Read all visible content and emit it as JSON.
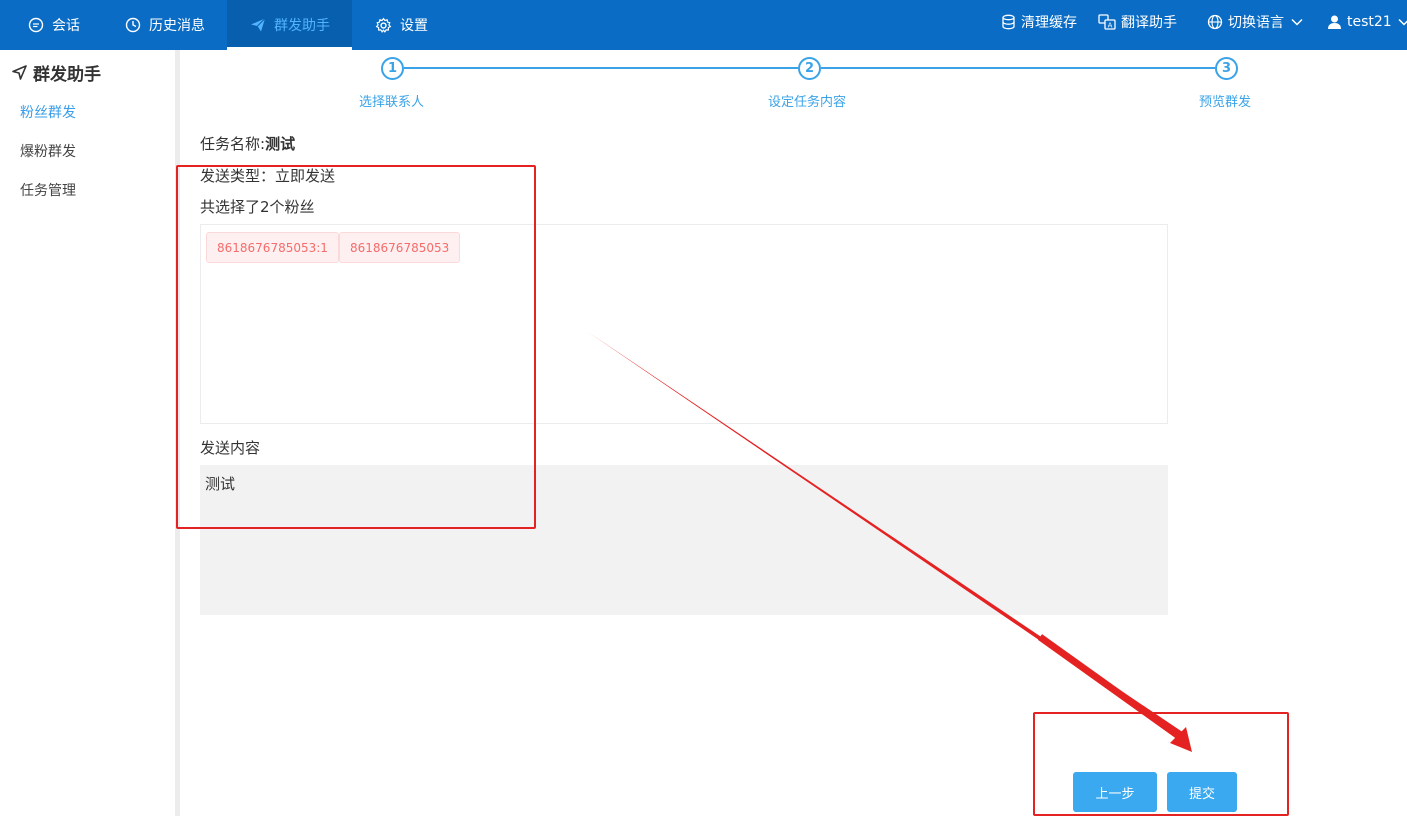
{
  "topnav": {
    "items": [
      {
        "label": "会话",
        "icon": "chat-icon"
      },
      {
        "label": "历史消息",
        "icon": "clock-icon"
      },
      {
        "label": "群发助手",
        "icon": "send-icon"
      },
      {
        "label": "设置",
        "icon": "gear-icon"
      }
    ],
    "active_index": 2,
    "right": {
      "clear_cache": "清理缓存",
      "translate": "翻译助手",
      "language": "切换语言",
      "user": "test21"
    }
  },
  "sidebar": {
    "title": "群发助手",
    "items": [
      "粉丝群发",
      "爆粉群发",
      "任务管理"
    ],
    "active_index": 0
  },
  "steps": [
    {
      "number": "1",
      "label": "选择联系人"
    },
    {
      "number": "2",
      "label": "设定任务内容"
    },
    {
      "number": "3",
      "label": "预览群发"
    }
  ],
  "task": {
    "name_label": "任务名称:",
    "name_value": "测试",
    "send_type": "发送类型：立即发送",
    "selected_count": "共选择了2个粉丝",
    "fans": [
      "8618676785053:1",
      "8618676785053"
    ],
    "content_label": "发送内容",
    "content_value": "测试"
  },
  "buttons": {
    "prev": "上一步",
    "submit": "提交"
  },
  "colors": {
    "topbar": "#0a6cc4",
    "accent": "#3aa3e8",
    "annotation": "#e52222"
  }
}
